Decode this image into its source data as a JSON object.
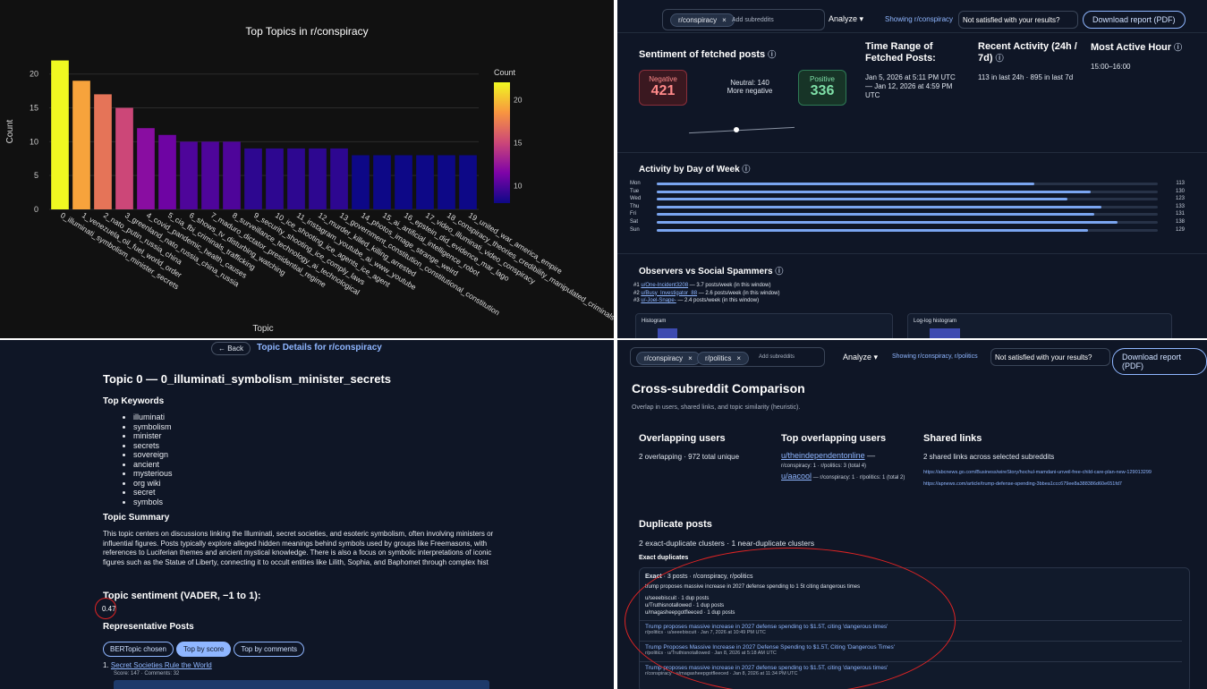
{
  "q1": {
    "title": "Top Topics in r/conspiracy",
    "ylabel": "Count",
    "xlabel": "Topic",
    "colorbar_title": "Count",
    "colorbar_ticks": [
      "20",
      "15",
      "10"
    ],
    "y_ticks": [
      "0",
      "5",
      "10",
      "15",
      "20"
    ]
  },
  "chart_data": {
    "type": "bar",
    "title": "Top Topics in r/conspiracy",
    "xlabel": "Topic",
    "ylabel": "Count",
    "ylim": [
      0,
      23
    ],
    "categories": [
      "0_illuminati_symbolism_minister_secrets",
      "1_venezuela_oil_fuel_world_order",
      "2_nato_putin_russia_china",
      "3_greenland_nato_russia_china_russia",
      "4_covid_pandemic_health_causes",
      "5_cia_fbi_criminals_trafficking",
      "6_shows_tv_disturbing_watching",
      "7_maduro_dictator_presidential_regime",
      "8_surveillance_technology_ai_technological",
      "9_security_shooting_ice_comply_laws",
      "10_ice_shooting_ice_agents_ice_agent",
      "11_instagram_youtube_ai_www_youtube",
      "12_murder_killed_killing_arrested",
      "13_government_constitution_constitutional_constitution",
      "14_photos_image_strange_weird",
      "15_ai_artificial_intelligence_robot",
      "16_epstein_did_evidence_mar_lago",
      "17_video_illuminati_video_conspiracy",
      "18_conspiracy_theories_credibility_manipulated_criminals",
      "19_united_war_america_empire"
    ],
    "values": [
      22,
      19,
      17,
      15,
      12,
      11,
      10,
      10,
      10,
      9,
      9,
      9,
      9,
      9,
      8,
      8,
      8,
      8,
      8,
      8
    ],
    "colorbar_range": [
      8,
      22
    ]
  },
  "q2": {
    "chip": "r/conspiracy",
    "add_placeholder": "Add subreddits",
    "analyze": "Analyze",
    "showing": "Showing r/conspiracy",
    "not_satisfied": "Not satisfied with your results?",
    "download": "Download report (PDF)",
    "sentiment_title": "Sentiment of fetched posts",
    "negative_label": "Negative",
    "negative_value": "421",
    "neutral_line1": "Neutral: 140",
    "neutral_line2": "More negative",
    "positive_label": "Positive",
    "positive_value": "336",
    "slider_position": 0.45,
    "time_range_title": "Time Range of Fetched Posts:",
    "time_range_value": "Jan 5, 2026 at 5:11 PM UTC — Jan 12, 2026 at 4:59 PM UTC",
    "recent_title": "Recent Activity (24h / 7d)",
    "recent_value": "113 in last 24h · 895 in last 7d",
    "active_hour_title": "Most Active Hour",
    "active_hour_value": "15:00–16:00",
    "dow_title": "Activity by Day of Week",
    "days": [
      {
        "day": "Mon",
        "value": 113
      },
      {
        "day": "Tue",
        "value": 130
      },
      {
        "day": "Wed",
        "value": 123
      },
      {
        "day": "Thu",
        "value": 133
      },
      {
        "day": "Fri",
        "value": 131
      },
      {
        "day": "Sat",
        "value": 138
      },
      {
        "day": "Sun",
        "value": 129
      }
    ],
    "observers_title": "Observers vs Social Spammers",
    "observers": [
      {
        "rank": "#1",
        "user": "u/One-Incident3208",
        "rate": " — 3.7 posts/week (in this window)"
      },
      {
        "rank": "#2",
        "user": "u/Busy_Investigator_88",
        "rate": " — 2.6 posts/week (in this window)"
      },
      {
        "rank": "#3",
        "user": "u/-Joel-Snape-",
        "rate": " — 2.4 posts/week (in this window)"
      }
    ],
    "histogram_label": "Histogram",
    "loglog_label": "Log-log histogram"
  },
  "q3": {
    "back": "← Back",
    "header": "Topic Details for r/conspiracy",
    "topic_title": "Topic 0 — 0_illuminati_symbolism_minister_secrets",
    "keywords_title": "Top Keywords",
    "keywords": [
      "illuminati",
      "symbolism",
      "minister",
      "secrets",
      "sovereign",
      "ancient",
      "mysterious",
      "org wiki",
      "secret",
      "symbols"
    ],
    "summary_title": "Topic Summary",
    "summary": "This topic centers on discussions linking the Illuminati, secret societies, and esoteric symbolism, often involving ministers or influential figures. Posts typically explore alleged hidden meanings behind symbols used by groups like Freemasons, with references to Luciferian themes and ancient mystical knowledge. There is also a focus on symbolic interpretations of iconic figures such as the Statue of Liberty, connecting it to occult entities like Lilith, Sophia, and Baphomet through complex hist",
    "sentiment_title": "Topic sentiment (VADER, −1 to 1):",
    "sentiment_value": "0.47",
    "rep_title": "Representative Posts",
    "pills": [
      "BERTopic chosen",
      "Top by score",
      "Top by comments"
    ],
    "post_title": "Secret Societies Rule the World",
    "post_meta": "Score: 147 · Comments: 32"
  },
  "q4": {
    "chip1": "r/conspiracy",
    "chip2": "r/politics",
    "add_placeholder": "Add subreddits",
    "analyze": "Analyze",
    "showing": "Showing r/conspiracy, r/politics",
    "not_satisfied": "Not satisfied with your results?",
    "download": "Download report (PDF)",
    "title": "Cross-subreddit Comparison",
    "subtitle": "Overlap in users, shared links, and topic similarity (heuristic).",
    "overlap_title": "Overlapping users",
    "overlap_value": "2 overlapping · 972 total unique",
    "top_overlap_title": "Top overlapping users",
    "top_user1": "u/theindependentonline",
    "top_user1_suffix": " —",
    "top_user1_meta": "r/conspiracy: 1 · r/politics: 3 (total 4)",
    "top_user2": "u/aacool",
    "top_user2_meta": " — r/conspiracy: 1 · r/politics: 1 (total 2)",
    "shared_title": "Shared links",
    "shared_value": "2 shared links across selected subreddits",
    "link1": "https://abcnews.go.com/Business/wireStory/hochul-mamdani-unveil-free-child-care-plan-new-129013299",
    "link2": "https://apnews.com/article/trump-defense-spending-3bbea1ccc679ee8a388386d60e651fd7",
    "dup_title": "Duplicate posts",
    "dup_summary": "2 exact-duplicate clusters · 1 near-duplicate clusters",
    "exact_label": "Exact duplicates",
    "cluster_head_bold": "Exact",
    "cluster_head_rest": " · 3 posts · r/conspiracy, r/politics",
    "cluster_title": "trump proposes massive increase in 2027 defense spending to 1 5t citing dangerous times",
    "cluster_users": [
      "u/seeebiscuit · 1 dup posts",
      "u/Truthisnotallowed · 1 dup posts",
      "u/magasheepgotfleeced · 1 dup posts"
    ],
    "dups": [
      {
        "title": "Trump proposes massive increase in 2027 defense spending to $1.5T, citing 'dangerous times'",
        "meta": "r/politics · u/seeebiscuit · Jan 7, 2026 at 10:49 PM UTC"
      },
      {
        "title": "Trump Proposes Massive Increase in 2027 Defense Spending to $1.5T, Citing 'Dangerous Times'",
        "meta": "r/politics · u/Truthisnotallowed · Jan 8, 2026 at 5:18 AM UTC"
      },
      {
        "title": "Trump proposes massive increase in 2027 defense spending to $1.5T, citing 'dangerous times'",
        "meta": "r/conspiracy · u/magasheepgotfleeced · Jan 8, 2026 at 11:34 PM UTC"
      }
    ]
  }
}
